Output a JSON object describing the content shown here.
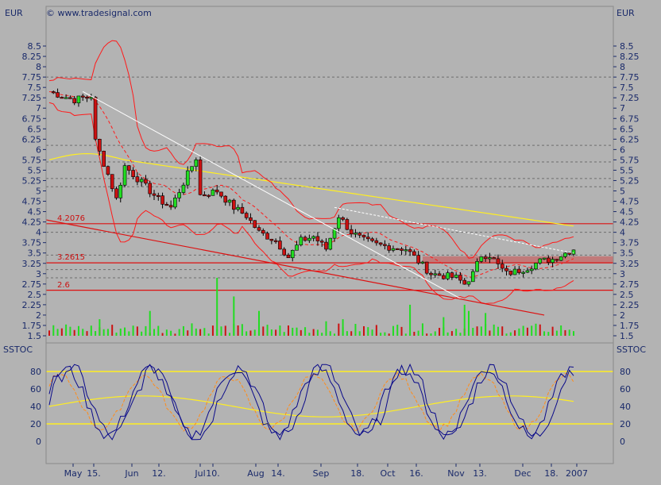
{
  "header": {
    "currency_left": "EUR",
    "currency_right": "EUR",
    "copyright": "© www.tradesignal.com"
  },
  "sstoc_label": "SSTOC",
  "levels": [
    {
      "label": "4.2076",
      "value": 4.2076
    },
    {
      "label": "3.2615",
      "value": 3.2615
    },
    {
      "label": "2.6",
      "value": 2.6
    }
  ],
  "colors": {
    "background": "#b3b3b3",
    "bollinger": "#ff1a1a",
    "moving_average": "#ffee22",
    "up_candle": "#22dd22",
    "down_candle": "#cc1111",
    "trendline": "#ffffff",
    "level_line": "#dd1111",
    "stoch_fast": "#0a0a8a",
    "stoch_slow": "#ff8c1a",
    "stoch_signal": "#ffee22",
    "axis_text": "#1a2a6a"
  },
  "chart_data": [
    {
      "type": "candlestick",
      "title": "",
      "ylabel": "EUR",
      "ylim": [
        1.5,
        8.5
      ],
      "yticks": [
        1.5,
        1.75,
        2,
        2.25,
        2.5,
        2.75,
        3,
        3.25,
        3.5,
        3.75,
        4,
        4.25,
        4.5,
        4.75,
        5,
        5.25,
        5.5,
        5.75,
        6,
        6.25,
        6.5,
        6.75,
        7,
        7.25,
        7.5,
        7.75,
        8,
        8.25,
        8.5
      ],
      "xticks": [
        "May",
        "15.",
        "Jun",
        "12.",
        "Jul",
        "10.",
        "Aug",
        "14.",
        "Sep",
        "18.",
        "Oct",
        "16.",
        "Nov",
        "13.",
        "Dec",
        "18.",
        "2007"
      ],
      "dashed_grid_levels": [
        2.9,
        3.1,
        3.45,
        4,
        5.1,
        5.3,
        5.7,
        6.1,
        7.75
      ],
      "close_keypoints": [
        {
          "i": 0,
          "v": 7.4
        },
        {
          "i": 6,
          "v": 7.2
        },
        {
          "i": 10,
          "v": 7.3
        },
        {
          "i": 11,
          "v": 6.2
        },
        {
          "i": 14,
          "v": 5.4
        },
        {
          "i": 16,
          "v": 4.8
        },
        {
          "i": 18,
          "v": 5.6
        },
        {
          "i": 22,
          "v": 5.2
        },
        {
          "i": 26,
          "v": 4.8
        },
        {
          "i": 29,
          "v": 4.6
        },
        {
          "i": 32,
          "v": 5.2
        },
        {
          "i": 35,
          "v": 5.8
        },
        {
          "i": 36,
          "v": 4.9
        },
        {
          "i": 40,
          "v": 5.0
        },
        {
          "i": 44,
          "v": 4.6
        },
        {
          "i": 47,
          "v": 4.4
        },
        {
          "i": 50,
          "v": 4.0
        },
        {
          "i": 54,
          "v": 3.8
        },
        {
          "i": 57,
          "v": 3.4
        },
        {
          "i": 60,
          "v": 3.8
        },
        {
          "i": 63,
          "v": 3.9
        },
        {
          "i": 66,
          "v": 3.6
        },
        {
          "i": 69,
          "v": 4.4
        },
        {
          "i": 72,
          "v": 4.0
        },
        {
          "i": 75,
          "v": 3.8
        },
        {
          "i": 78,
          "v": 3.7
        },
        {
          "i": 81,
          "v": 3.65
        },
        {
          "i": 85,
          "v": 3.6
        },
        {
          "i": 88,
          "v": 3.3
        },
        {
          "i": 91,
          "v": 3.0
        },
        {
          "i": 94,
          "v": 2.95
        },
        {
          "i": 97,
          "v": 2.9
        },
        {
          "i": 99,
          "v": 2.75
        },
        {
          "i": 101,
          "v": 3.0
        },
        {
          "i": 103,
          "v": 3.45
        },
        {
          "i": 105,
          "v": 3.45
        },
        {
          "i": 107,
          "v": 3.2
        },
        {
          "i": 109,
          "v": 3.0
        },
        {
          "i": 111,
          "v": 3.05
        },
        {
          "i": 114,
          "v": 3.15
        },
        {
          "i": 117,
          "v": 3.3
        },
        {
          "i": 120,
          "v": 3.35
        },
        {
          "i": 123,
          "v": 3.5
        },
        {
          "i": 125,
          "v": 3.6
        }
      ],
      "volume_bars": [
        {
          "i": 12,
          "v": 1.9
        },
        {
          "i": 18,
          "v": 1.7
        },
        {
          "i": 24,
          "v": 2.1
        },
        {
          "i": 34,
          "v": 1.8
        },
        {
          "i": 40,
          "v": 2.9
        },
        {
          "i": 44,
          "v": 2.45
        },
        {
          "i": 50,
          "v": 2.1
        },
        {
          "i": 66,
          "v": 1.85
        },
        {
          "i": 70,
          "v": 1.9
        },
        {
          "i": 86,
          "v": 2.25
        },
        {
          "i": 94,
          "v": 1.95
        },
        {
          "i": 99,
          "v": 2.25
        },
        {
          "i": 100,
          "v": 2.1
        },
        {
          "i": 104,
          "v": 2.05
        }
      ]
    },
    {
      "type": "line",
      "title": "",
      "ylabel": "SSTOC",
      "ylim": [
        0,
        90
      ],
      "yticks": [
        0,
        20,
        40,
        60,
        80
      ],
      "reference_lines": [
        20,
        80
      ]
    }
  ]
}
